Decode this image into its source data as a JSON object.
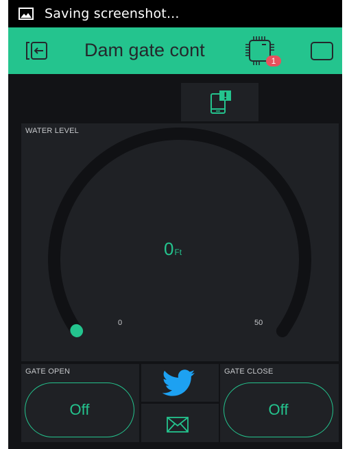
{
  "status_bar": {
    "icon": "image-icon",
    "text": "Saving screenshot..."
  },
  "app_bar": {
    "title": "Dam gate cont",
    "back_icon": "exit-icon",
    "device_icon": "chip-icon",
    "device_badge": "1",
    "stop_icon": "stop-icon",
    "color": "#24c48e"
  },
  "notification": {
    "icon": "device-alert-icon"
  },
  "gauge": {
    "label": "WATER LEVEL",
    "value": "0",
    "unit": "Ft",
    "min": "0",
    "max": "50",
    "level": 0,
    "accent": "#24c48e",
    "track": "#101114"
  },
  "gate_open": {
    "label": "GATE OPEN",
    "button": "Off"
  },
  "gate_close": {
    "label": "GATE CLOSE",
    "button": "Off"
  },
  "twitter": {
    "icon": "twitter-bird-icon",
    "color": "#1da1f2"
  },
  "email": {
    "icon": "envelope-icon"
  }
}
